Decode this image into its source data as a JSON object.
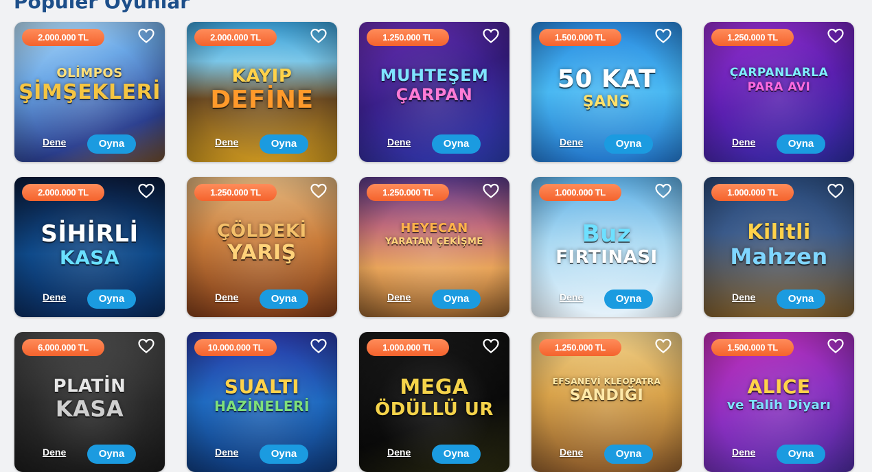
{
  "section": {
    "title": "Popüler Oyunlar"
  },
  "games": [
    {
      "prize": "2.000.000 TL",
      "line1": "OLİMPOS",
      "line2": "ŞİMŞEKLERİ",
      "bg": "linear-gradient(160deg,#bfe6ff 0%,#6aa7e6 35%,#2b3f8f 75%,#6c4a2a 100%)",
      "c1": "#ffe07a",
      "c2": "#f5c542",
      "s1": 18,
      "s2": 30
    },
    {
      "prize": "2.000.000 TL",
      "line1": "KAYIP",
      "line2": "DEFİNE",
      "bg": "linear-gradient(180deg,#3aa0d8 0%,#7ac6e8 28%,#6b4a22 55%,#c8941f 100%)",
      "c1": "#ffd24a",
      "c2": "#ff9a2b",
      "s1": 26,
      "s2": 36
    },
    {
      "prize": "1.250.000 TL",
      "line1": "MUHTEŞEM",
      "line2": "ÇARPAN",
      "bg": "linear-gradient(160deg,#6d2fb6 0%,#3a1f8a 45%,#2a3aa8 100%)",
      "c1": "#7fe3ff",
      "c2": "#ff7bd6",
      "s1": 24,
      "s2": 24
    },
    {
      "prize": "1.500.000 TL",
      "line1": "50 KAT",
      "line2": "ŞANS",
      "bg": "linear-gradient(180deg,#2a8ae0 0%,#49b8f2 50%,#2376c9 100%)",
      "c1": "#ffffff",
      "c2": "#ffe16a",
      "s1": 36,
      "s2": 22
    },
    {
      "prize": "1.250.000 TL",
      "line1": "ÇARPANLARLA",
      "line2": "PARA AVI",
      "bg": "linear-gradient(160deg,#9a2fd1 0%,#5b1fb0 50%,#2b2a9a 100%)",
      "c1": "#7ff0ff",
      "c2": "#ff6ae0",
      "s1": 17,
      "s2": 17
    },
    {
      "prize": "2.000.000 TL",
      "line1": "SİHİRLİ",
      "line2": "KASA",
      "bg": "linear-gradient(180deg,#0a1a3a 0%,#0f4a8a 55%,#0a2a5a 100%)",
      "c1": "#ffffff",
      "c2": "#6ae0ff",
      "s1": 34,
      "s2": 28
    },
    {
      "prize": "1.250.000 TL",
      "line1": "ÇÖLDEKİ",
      "line2": "YARIŞ",
      "bg": "linear-gradient(180deg,#e6b980 0%,#c97c3a 45%,#7a3a18 100%)",
      "c1": "#f4c06a",
      "c2": "#ffd27a",
      "s1": 26,
      "s2": 30
    },
    {
      "prize": "1.250.000 TL",
      "line1": "HEYECAN",
      "line2": "YARATAN ÇEKİŞME",
      "bg": "linear-gradient(180deg,#5a3a8a 0%,#c06a7a 35%,#e8a45a 65%,#8a5a2a 100%)",
      "c1": "#ffb24a",
      "c2": "#ffd27a",
      "s1": 18,
      "s2": 13
    },
    {
      "prize": "1.000.000 TL",
      "line1": "Buz",
      "line2": "FIRTINASI",
      "bg": "linear-gradient(180deg,#5fb0e6 0%,#a8d8f2 45%,#e6f2fa 100%)",
      "c1": "#6ee0ff",
      "c2": "#ffffff",
      "s1": 34,
      "s2": 26
    },
    {
      "prize": "1.000.000 TL",
      "line1": "Kilitli",
      "line2": "Mahzen",
      "bg": "linear-gradient(180deg,#2a4a7a 0%,#3a5a8a 40%,#7a5a2a 100%)",
      "c1": "#ffd24a",
      "c2": "#7fd6ff",
      "s1": 30,
      "s2": 32
    },
    {
      "prize": "6.000.000 TL",
      "line1": "PLATİN",
      "line2": "KASA",
      "bg": "linear-gradient(180deg,#4a4a4a 0%,#2a2a2a 50%,#1a1a1a 100%)",
      "c1": "#e6e6e6",
      "c2": "#cfcfcf",
      "s1": 26,
      "s2": 32
    },
    {
      "prize": "10.000.000 TL",
      "line1": "SUALTI",
      "line2": "HAZİNELERİ",
      "bg": "linear-gradient(180deg,#2a3aa8 0%,#1f6ac0 50%,#0f3a7a 100%)",
      "c1": "#ffd24a",
      "c2": "#7fe07a",
      "s1": 28,
      "s2": 20
    },
    {
      "prize": "1.000.000 TL",
      "line1": "MEGA",
      "line2": "ÖDÜLLÜ UR",
      "bg": "linear-gradient(160deg,#1a1a1a 0%,#0a0a0a 60%,#2a2a10 100%)",
      "c1": "#f5d34a",
      "c2": "#f5d34a",
      "s1": 30,
      "s2": 26
    },
    {
      "prize": "1.250.000 TL",
      "line1": "EFSANEVİ KLEOPATRA",
      "line2": "SANDIĞI",
      "bg": "linear-gradient(180deg,#f2d28a 0%,#d8a24a 45%,#8a5a2a 100%)",
      "c1": "#ffe9a8",
      "c2": "#ffe9a8",
      "s1": 12,
      "s2": 22
    },
    {
      "prize": "1.500.000 TL",
      "line1": "ALICE",
      "line2": "ve Talih Diyarı",
      "bg": "linear-gradient(160deg,#c82fb8 0%,#8a2fc0 50%,#4a2a9a 100%)",
      "c1": "#ffd24a",
      "c2": "#7fe3ff",
      "s1": 28,
      "s2": 18
    }
  ],
  "labels": {
    "dene": "Dene",
    "oyna": "Oyna"
  },
  "icons": {
    "favorite": "heart-outline-icon"
  }
}
